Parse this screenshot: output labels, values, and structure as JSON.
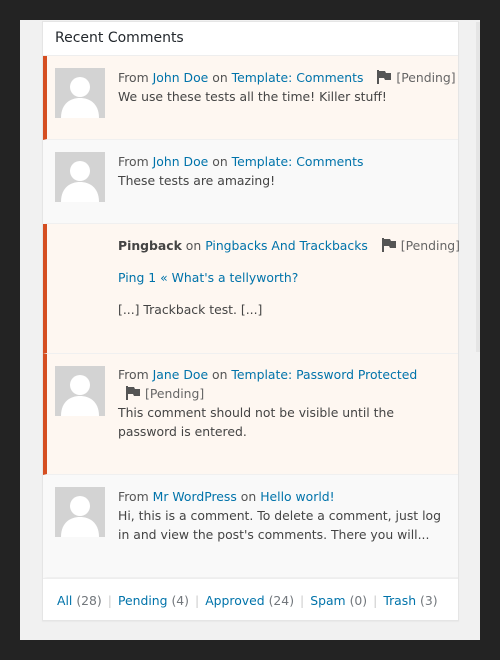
{
  "widget": {
    "title": "Recent Comments"
  },
  "labels": {
    "from": "From",
    "on": "on",
    "pending": "[Pending]"
  },
  "comments": [
    {
      "author": "John Doe",
      "post": "Template: Comments",
      "text": "We use these tests all the time! Killer stuff!",
      "pending": true
    },
    {
      "author": "John Doe",
      "post": "Template: Comments",
      "text": "These tests are amazing!",
      "pending": false
    },
    {
      "type": "Pingback",
      "post": "Pingbacks And Trackbacks",
      "link_title": "Ping 1 « What's a tellyworth?",
      "text": "[...] Trackback test. [...]",
      "pending": true
    },
    {
      "author": "Jane Doe",
      "post": "Template: Password Protected",
      "text": "This comment should not be visible until the password is entered.",
      "pending": true
    },
    {
      "author": "Mr WordPress",
      "post": "Hello world!",
      "text": "Hi, this is a comment. To delete a comment, just log in and view the post's comments. There you will...",
      "pending": false
    }
  ],
  "footer": {
    "all": {
      "label": "All",
      "count": "(28)"
    },
    "pending": {
      "label": "Pending",
      "count": "(4)"
    },
    "approved": {
      "label": "Approved",
      "count": "(24)"
    },
    "spam": {
      "label": "Spam",
      "count": "(0)"
    },
    "trash": {
      "label": "Trash",
      "count": "(3)"
    }
  },
  "colors": {
    "accent": "#0073aa",
    "pending_border": "#d54e21",
    "pending_bg": "#fef7f1",
    "backdrop": "#232323"
  },
  "icons": {
    "flag": "flag-icon",
    "avatar": "avatar-placeholder-icon"
  }
}
